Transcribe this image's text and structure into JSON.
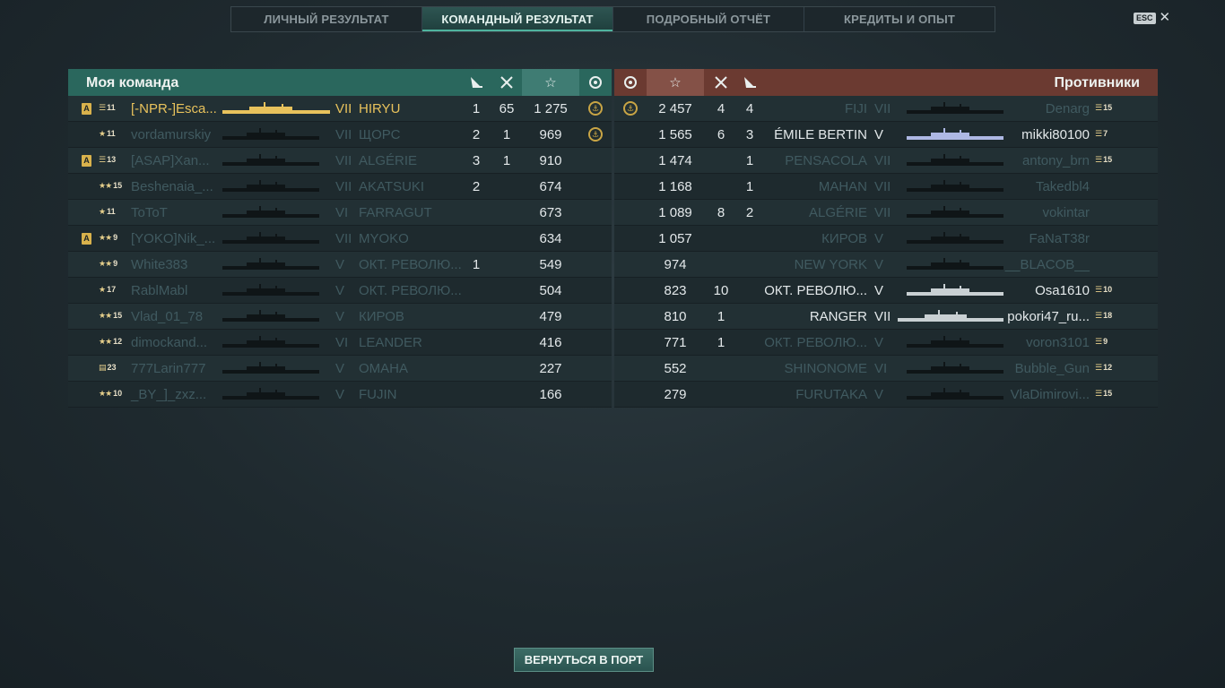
{
  "tabs": [
    {
      "label": "ЛИЧНЫЙ РЕЗУЛЬТАТ",
      "active": false
    },
    {
      "label": "КОМАНДНЫЙ РЕЗУЛЬТАТ",
      "active": true
    },
    {
      "label": "ПОДРОБНЫЙ ОТЧЁТ",
      "active": false
    },
    {
      "label": "КРЕДИТЫ И ОПЫТ",
      "active": false
    }
  ],
  "esc_label": "ESC",
  "close_glyph": "✕",
  "colors": {
    "accent_team": "#2a675d",
    "accent_enemy": "#6b3a31",
    "gold": "#e8c25c"
  },
  "my_team": {
    "title": "Моя команда",
    "columns": {
      "planes": "plane-icon",
      "frags": "swords-icon",
      "xp": "☆",
      "medal": "medal-icon"
    },
    "rows": [
      {
        "a": true,
        "rank": "11",
        "rank_icon": "lieutenant",
        "name": "[-NPR-]Esca...",
        "tier": "VII",
        "ship": "HIRYU",
        "planes": "1",
        "frags": "65",
        "xp": "1 275",
        "medal": true,
        "highlight": "gold",
        "ship_style": "gold"
      },
      {
        "a": false,
        "rank": "11",
        "rank_icon": "ensign",
        "name": "vordamurskiy",
        "tier": "VII",
        "ship": "ЩОРС",
        "planes": "2",
        "frags": "1",
        "xp": "969",
        "medal": true,
        "highlight": "dim"
      },
      {
        "a": true,
        "rank": "13",
        "rank_icon": "lieutenant",
        "name": "[ASAP]Xan...",
        "tier": "VII",
        "ship": "ALGÉRIE",
        "planes": "3",
        "frags": "1",
        "xp": "910",
        "medal": false,
        "highlight": "dim"
      },
      {
        "a": false,
        "rank": "15",
        "rank_icon": "captain",
        "name": "Beshenaia_...",
        "tier": "VII",
        "ship": "AKATSUKI",
        "planes": "2",
        "frags": "",
        "xp": "674",
        "medal": false,
        "highlight": "dim"
      },
      {
        "a": false,
        "rank": "11",
        "rank_icon": "ensign",
        "name": "ToToT",
        "tier": "VI",
        "ship": "FARRAGUT",
        "planes": "",
        "frags": "",
        "xp": "673",
        "medal": false,
        "highlight": "dim"
      },
      {
        "a": true,
        "rank": "9",
        "rank_icon": "captain",
        "name": "[YOKO]Nik_...",
        "tier": "VII",
        "ship": "MYOKO",
        "planes": "",
        "frags": "",
        "xp": "634",
        "medal": false,
        "highlight": "dim"
      },
      {
        "a": false,
        "rank": "9",
        "rank_icon": "captain",
        "name": "White383",
        "tier": "V",
        "ship": "ОКТ. РЕВОЛЮ...",
        "planes": "1",
        "frags": "",
        "xp": "549",
        "medal": false,
        "highlight": "dim"
      },
      {
        "a": false,
        "rank": "17",
        "rank_icon": "ensign",
        "name": "RablMabl",
        "tier": "V",
        "ship": "ОКТ. РЕВОЛЮ...",
        "planes": "",
        "frags": "",
        "xp": "504",
        "medal": false,
        "highlight": "dim"
      },
      {
        "a": false,
        "rank": "15",
        "rank_icon": "captain",
        "name": "Vlad_01_78",
        "tier": "V",
        "ship": "КИРОВ",
        "planes": "",
        "frags": "",
        "xp": "479",
        "medal": false,
        "highlight": "dim"
      },
      {
        "a": false,
        "rank": "12",
        "rank_icon": "captain",
        "name": "dimockand...",
        "tier": "VI",
        "ship": "LEANDER",
        "planes": "",
        "frags": "",
        "xp": "416",
        "medal": false,
        "highlight": "dim"
      },
      {
        "a": false,
        "rank": "23",
        "rank_icon": "stripes",
        "name": "777Larin777",
        "tier": "V",
        "ship": "OMAHA",
        "planes": "",
        "frags": "",
        "xp": "227",
        "medal": false,
        "highlight": "dim"
      },
      {
        "a": false,
        "rank": "10",
        "rank_icon": "captain",
        "name": "_BY_]_zxz...",
        "tier": "V",
        "ship": "FUJIN",
        "planes": "",
        "frags": "",
        "xp": "166",
        "medal": false,
        "highlight": "dim"
      }
    ]
  },
  "enemy_team": {
    "title": "Противники",
    "rows": [
      {
        "medal": true,
        "xp": "2 457",
        "frags": "4",
        "planes": "4",
        "ship": "FIJI",
        "tier": "VII",
        "name": "Denarg",
        "rank": "15",
        "highlight": "dim"
      },
      {
        "medal": false,
        "xp": "1 565",
        "frags": "6",
        "planes": "3",
        "ship": "ÉMILE BERTIN",
        "tier": "V",
        "name": "mikki80100",
        "rank": "7",
        "highlight": "bright",
        "ship_style": "blue"
      },
      {
        "medal": false,
        "xp": "1 474",
        "frags": "",
        "planes": "1",
        "ship": "PENSACOLA",
        "tier": "VII",
        "name": "antony_brn",
        "rank": "15",
        "highlight": "dim"
      },
      {
        "medal": false,
        "xp": "1 168",
        "frags": "",
        "planes": "1",
        "ship": "MAHAN",
        "tier": "VII",
        "name": "Takedbl4",
        "rank": "",
        "highlight": "dim"
      },
      {
        "medal": false,
        "xp": "1 089",
        "frags": "8",
        "planes": "2",
        "ship": "ALGÉRIE",
        "tier": "VII",
        "name": "vokintar",
        "rank": "",
        "highlight": "dim"
      },
      {
        "medal": false,
        "xp": "1 057",
        "frags": "",
        "planes": "",
        "ship": "КИРОВ",
        "tier": "V",
        "name": "FaNaT38r",
        "rank": "",
        "highlight": "dim"
      },
      {
        "medal": false,
        "xp": "974",
        "frags": "",
        "planes": "",
        "ship": "NEW YORK",
        "tier": "V",
        "name": "__BLACOB__",
        "rank": "",
        "highlight": "dim"
      },
      {
        "medal": false,
        "xp": "823",
        "frags": "10",
        "planes": "",
        "ship": "ОКТ. РЕВОЛЮ...",
        "tier": "V",
        "name": "Osa1610",
        "rank": "10",
        "highlight": "bright",
        "ship_style": "white"
      },
      {
        "medal": false,
        "xp": "810",
        "frags": "1",
        "planes": "",
        "ship": "RANGER",
        "tier": "VII",
        "name": "pokori47_ru...",
        "rank": "18",
        "highlight": "bright",
        "ship_style": "white"
      },
      {
        "medal": false,
        "xp": "771",
        "frags": "1",
        "planes": "",
        "ship": "ОКТ. РЕВОЛЮ...",
        "tier": "V",
        "name": "voron3101",
        "rank": "9",
        "highlight": "dim"
      },
      {
        "medal": false,
        "xp": "552",
        "frags": "",
        "planes": "",
        "ship": "SHINONOME",
        "tier": "VI",
        "name": "Bubble_Gun",
        "rank": "12",
        "highlight": "dim"
      },
      {
        "medal": false,
        "xp": "279",
        "frags": "",
        "planes": "",
        "ship": "FURUTAKA",
        "tier": "V",
        "name": "VlaDimirovi...",
        "rank": "15",
        "highlight": "dim"
      }
    ]
  },
  "return_button": "ВЕРНУТЬСЯ В ПОРТ"
}
